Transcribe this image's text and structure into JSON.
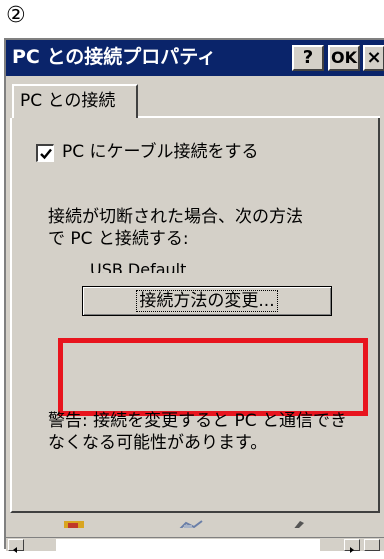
{
  "step_marker": "②",
  "window": {
    "title": "PC との接続プロパティ",
    "help_label": "?",
    "ok_label": "OK",
    "close_label": "×"
  },
  "tabs": [
    {
      "label": "PC との接続",
      "selected": true
    }
  ],
  "cable_checkbox": {
    "label": "PC にケーブル接続をする",
    "checked": true
  },
  "connection_info": {
    "line1": "接続が切断された場合、次の方法",
    "line2": "で PC と接続する:"
  },
  "current_method": "USB Default",
  "change_button_label": "接続方法の変更...",
  "warning": {
    "line1": "警告: 接続を変更すると PC と通信でき",
    "line2": "なくなる可能性があります。"
  },
  "highlight_color": "#e8141e",
  "titlebar_color": "#0a246a",
  "taskbar_icons": [
    "folder-icon",
    "network-icon",
    "pen-icon"
  ]
}
